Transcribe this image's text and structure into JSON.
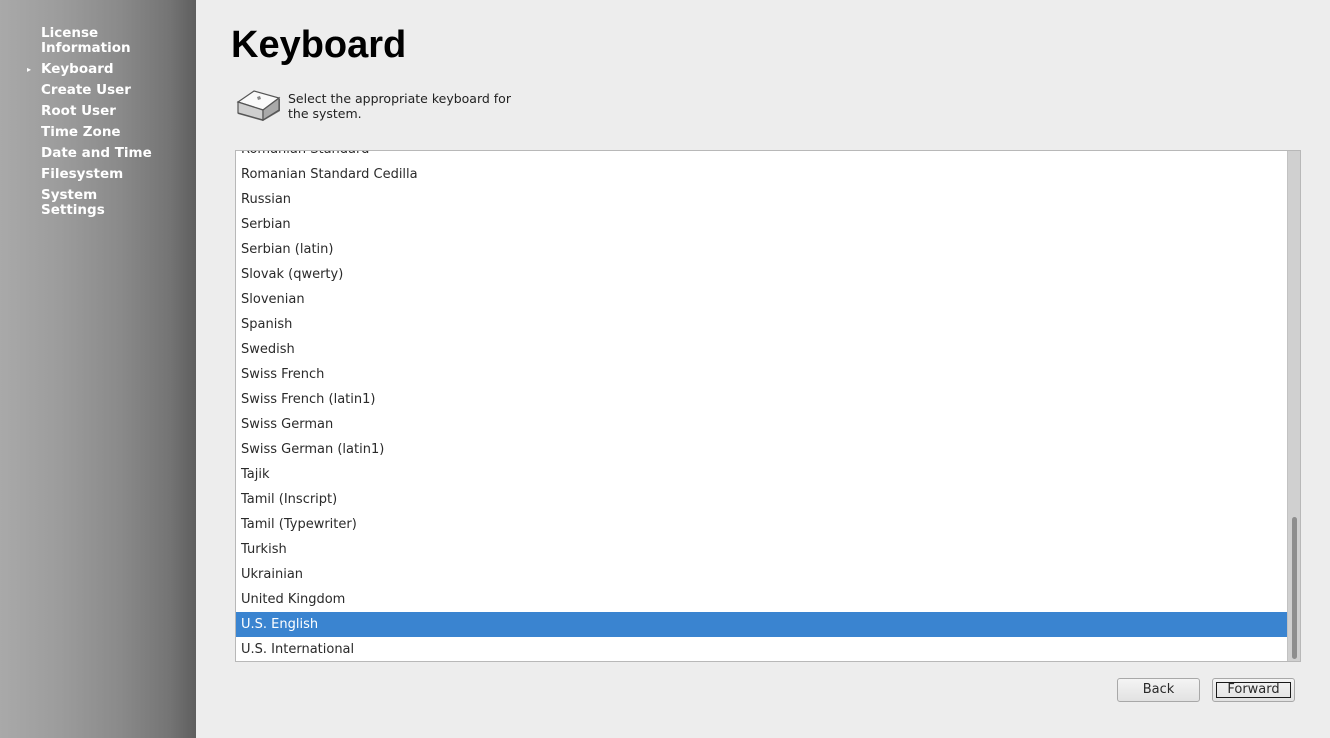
{
  "sidebar": {
    "items": [
      {
        "label": "License Information",
        "active": false
      },
      {
        "label": "Keyboard",
        "active": true
      },
      {
        "label": "Create User",
        "active": false
      },
      {
        "label": "Root User",
        "active": false
      },
      {
        "label": "Time Zone",
        "active": false
      },
      {
        "label": "Date and Time",
        "active": false
      },
      {
        "label": "Filesystem",
        "active": false
      },
      {
        "label": "System Settings",
        "active": false
      }
    ],
    "active_indicator": "▸"
  },
  "page": {
    "title": "Keyboard",
    "description": "Select the appropriate keyboard for the system.",
    "icon": "keyboard-key-icon"
  },
  "layouts": {
    "items": [
      "Romanian Standard",
      "Romanian Standard Cedilla",
      "Russian",
      "Serbian",
      "Serbian (latin)",
      "Slovak (qwerty)",
      "Slovenian",
      "Spanish",
      "Swedish",
      "Swiss French",
      "Swiss French (latin1)",
      "Swiss German",
      "Swiss German (latin1)",
      "Tajik",
      "Tamil (Inscript)",
      "Tamil (Typewriter)",
      "Turkish",
      "Ukrainian",
      "United Kingdom",
      "U.S. English",
      "U.S. International"
    ],
    "selected": "U.S. English",
    "selection_color": "#3a84d0"
  },
  "buttons": {
    "back": "Back",
    "forward": "Forward"
  }
}
